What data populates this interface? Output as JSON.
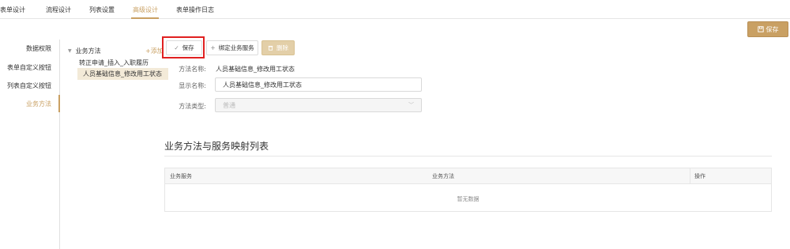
{
  "tabs": [
    {
      "label": "表单设计"
    },
    {
      "label": "流程设计"
    },
    {
      "label": "列表设置"
    },
    {
      "label": "高级设计"
    },
    {
      "label": "表单操作日志"
    }
  ],
  "active_tab": "高级设计",
  "header": {
    "save_label": "保存",
    "save_icon": "save-icon"
  },
  "left_nav": {
    "items": [
      {
        "label": "数据权限"
      },
      {
        "label": "表单自定义按钮"
      },
      {
        "label": "列表自定义按钮"
      },
      {
        "label": "业务方法"
      }
    ],
    "active": "业务方法"
  },
  "tree": {
    "root_label": "业务方法",
    "add_label": "+添加",
    "children": [
      {
        "label": "转正申请_插入_入职履历"
      },
      {
        "label": "人员基础信息_修改用工状态"
      }
    ],
    "selected": "人员基础信息_修改用工状态"
  },
  "toolbar": {
    "save_label": "保存",
    "bind_label": "绑定业务服务",
    "delete_label": "删除"
  },
  "form": {
    "method_name_label": "方法名称:",
    "method_name_value": "人员基础信息_修改用工状态",
    "display_name_label": "显示名称:",
    "display_name_value": "人员基础信息_修改用工状态",
    "method_type_label": "方法类型:",
    "method_type_value": "普通"
  },
  "section": {
    "title": "业务方法与服务映射列表"
  },
  "table": {
    "columns": [
      "业务服务",
      "业务方法",
      "操作"
    ],
    "empty_text": "暂无数据"
  },
  "colors": {
    "accent": "#c9a063",
    "highlight": "#e02020",
    "selected_bg": "#f3ead8"
  }
}
